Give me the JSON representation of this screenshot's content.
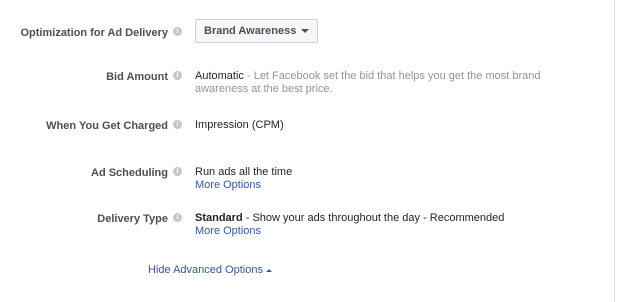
{
  "optimization": {
    "label": "Optimization for Ad Delivery",
    "info_icon": "info-icon",
    "dropdown_value": "Brand Awareness"
  },
  "bid_amount": {
    "label": "Bid Amount",
    "info_icon": "info-icon",
    "value_strong": "Automatic",
    "value_desc_line1": " - Let Facebook set the bid that helps you get the most brand",
    "value_desc_line2": "awareness at the best price."
  },
  "charged": {
    "label": "When You Get Charged",
    "info_icon": "info-icon",
    "value": "Impression (CPM)"
  },
  "scheduling": {
    "label": "Ad Scheduling",
    "info_icon": "info-icon",
    "value": "Run ads all the time",
    "more_options": "More Options"
  },
  "delivery_type": {
    "label": "Delivery Type",
    "info_icon": "info-icon",
    "value_strong": "Standard",
    "value_rest": " - Show your ads throughout the day - Recommended",
    "more_options": "More Options"
  },
  "advanced": {
    "toggle_label": "Hide Advanced Options"
  },
  "colors": {
    "link": "#365899",
    "label": "#4b4f56",
    "muted": "#90949c",
    "icon": "#c4c6ca"
  }
}
